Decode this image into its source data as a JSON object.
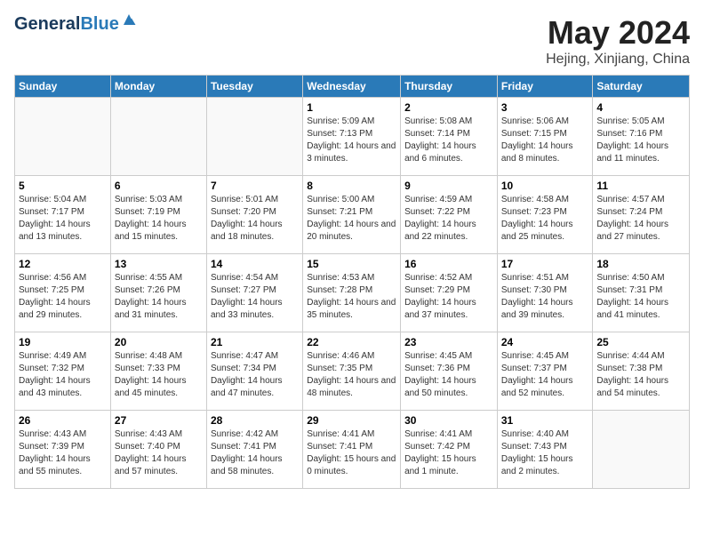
{
  "header": {
    "logo_line1": "General",
    "logo_line2": "Blue",
    "month": "May 2024",
    "location": "Hejing, Xinjiang, China"
  },
  "weekdays": [
    "Sunday",
    "Monday",
    "Tuesday",
    "Wednesday",
    "Thursday",
    "Friday",
    "Saturday"
  ],
  "weeks": [
    [
      {
        "day": "",
        "detail": ""
      },
      {
        "day": "",
        "detail": ""
      },
      {
        "day": "",
        "detail": ""
      },
      {
        "day": "1",
        "detail": "Sunrise: 5:09 AM\nSunset: 7:13 PM\nDaylight: 14 hours and 3 minutes."
      },
      {
        "day": "2",
        "detail": "Sunrise: 5:08 AM\nSunset: 7:14 PM\nDaylight: 14 hours and 6 minutes."
      },
      {
        "day": "3",
        "detail": "Sunrise: 5:06 AM\nSunset: 7:15 PM\nDaylight: 14 hours and 8 minutes."
      },
      {
        "day": "4",
        "detail": "Sunrise: 5:05 AM\nSunset: 7:16 PM\nDaylight: 14 hours and 11 minutes."
      }
    ],
    [
      {
        "day": "5",
        "detail": "Sunrise: 5:04 AM\nSunset: 7:17 PM\nDaylight: 14 hours and 13 minutes."
      },
      {
        "day": "6",
        "detail": "Sunrise: 5:03 AM\nSunset: 7:19 PM\nDaylight: 14 hours and 15 minutes."
      },
      {
        "day": "7",
        "detail": "Sunrise: 5:01 AM\nSunset: 7:20 PM\nDaylight: 14 hours and 18 minutes."
      },
      {
        "day": "8",
        "detail": "Sunrise: 5:00 AM\nSunset: 7:21 PM\nDaylight: 14 hours and 20 minutes."
      },
      {
        "day": "9",
        "detail": "Sunrise: 4:59 AM\nSunset: 7:22 PM\nDaylight: 14 hours and 22 minutes."
      },
      {
        "day": "10",
        "detail": "Sunrise: 4:58 AM\nSunset: 7:23 PM\nDaylight: 14 hours and 25 minutes."
      },
      {
        "day": "11",
        "detail": "Sunrise: 4:57 AM\nSunset: 7:24 PM\nDaylight: 14 hours and 27 minutes."
      }
    ],
    [
      {
        "day": "12",
        "detail": "Sunrise: 4:56 AM\nSunset: 7:25 PM\nDaylight: 14 hours and 29 minutes."
      },
      {
        "day": "13",
        "detail": "Sunrise: 4:55 AM\nSunset: 7:26 PM\nDaylight: 14 hours and 31 minutes."
      },
      {
        "day": "14",
        "detail": "Sunrise: 4:54 AM\nSunset: 7:27 PM\nDaylight: 14 hours and 33 minutes."
      },
      {
        "day": "15",
        "detail": "Sunrise: 4:53 AM\nSunset: 7:28 PM\nDaylight: 14 hours and 35 minutes."
      },
      {
        "day": "16",
        "detail": "Sunrise: 4:52 AM\nSunset: 7:29 PM\nDaylight: 14 hours and 37 minutes."
      },
      {
        "day": "17",
        "detail": "Sunrise: 4:51 AM\nSunset: 7:30 PM\nDaylight: 14 hours and 39 minutes."
      },
      {
        "day": "18",
        "detail": "Sunrise: 4:50 AM\nSunset: 7:31 PM\nDaylight: 14 hours and 41 minutes."
      }
    ],
    [
      {
        "day": "19",
        "detail": "Sunrise: 4:49 AM\nSunset: 7:32 PM\nDaylight: 14 hours and 43 minutes."
      },
      {
        "day": "20",
        "detail": "Sunrise: 4:48 AM\nSunset: 7:33 PM\nDaylight: 14 hours and 45 minutes."
      },
      {
        "day": "21",
        "detail": "Sunrise: 4:47 AM\nSunset: 7:34 PM\nDaylight: 14 hours and 47 minutes."
      },
      {
        "day": "22",
        "detail": "Sunrise: 4:46 AM\nSunset: 7:35 PM\nDaylight: 14 hours and 48 minutes."
      },
      {
        "day": "23",
        "detail": "Sunrise: 4:45 AM\nSunset: 7:36 PM\nDaylight: 14 hours and 50 minutes."
      },
      {
        "day": "24",
        "detail": "Sunrise: 4:45 AM\nSunset: 7:37 PM\nDaylight: 14 hours and 52 minutes."
      },
      {
        "day": "25",
        "detail": "Sunrise: 4:44 AM\nSunset: 7:38 PM\nDaylight: 14 hours and 54 minutes."
      }
    ],
    [
      {
        "day": "26",
        "detail": "Sunrise: 4:43 AM\nSunset: 7:39 PM\nDaylight: 14 hours and 55 minutes."
      },
      {
        "day": "27",
        "detail": "Sunrise: 4:43 AM\nSunset: 7:40 PM\nDaylight: 14 hours and 57 minutes."
      },
      {
        "day": "28",
        "detail": "Sunrise: 4:42 AM\nSunset: 7:41 PM\nDaylight: 14 hours and 58 minutes."
      },
      {
        "day": "29",
        "detail": "Sunrise: 4:41 AM\nSunset: 7:41 PM\nDaylight: 15 hours and 0 minutes."
      },
      {
        "day": "30",
        "detail": "Sunrise: 4:41 AM\nSunset: 7:42 PM\nDaylight: 15 hours and 1 minute."
      },
      {
        "day": "31",
        "detail": "Sunrise: 4:40 AM\nSunset: 7:43 PM\nDaylight: 15 hours and 2 minutes."
      },
      {
        "day": "",
        "detail": ""
      }
    ]
  ]
}
